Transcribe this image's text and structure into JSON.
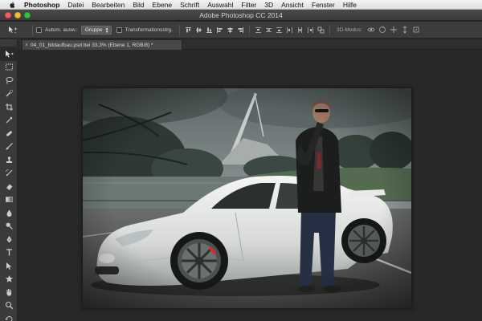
{
  "menubar": {
    "app": "Photoshop",
    "items": [
      "Datei",
      "Bearbeiten",
      "Bild",
      "Ebene",
      "Schrift",
      "Auswahl",
      "Filter",
      "3D",
      "Ansicht",
      "Fenster",
      "Hilfe"
    ]
  },
  "window": {
    "title": "Adobe Photoshop CC 2014"
  },
  "options": {
    "auto_select_label": "Autom. ausw.:",
    "auto_select_value": "Gruppe",
    "transform_label": "Transformationsstrg.",
    "mode_3d_label": "3D-Modus:"
  },
  "document": {
    "tab_label": "04_01_bildaufbau.psd bei 33,3% (Ebene 1, RGB/8) *"
  },
  "tools": [
    "move-tool",
    "marquee-tool",
    "lasso-tool",
    "quick-select-tool",
    "crop-tool",
    "eyedropper-tool",
    "spot-healing-tool",
    "brush-tool",
    "clone-stamp-tool",
    "history-brush-tool",
    "eraser-tool",
    "gradient-tool",
    "blur-tool",
    "dodge-tool",
    "pen-tool",
    "type-tool",
    "path-select-tool",
    "shape-tool",
    "hand-tool",
    "zoom-tool"
  ],
  "colors": {
    "menubar_bg": "#e8e8e8",
    "chrome_dark": "#3c3c3c",
    "canvas_bg": "#282828"
  }
}
